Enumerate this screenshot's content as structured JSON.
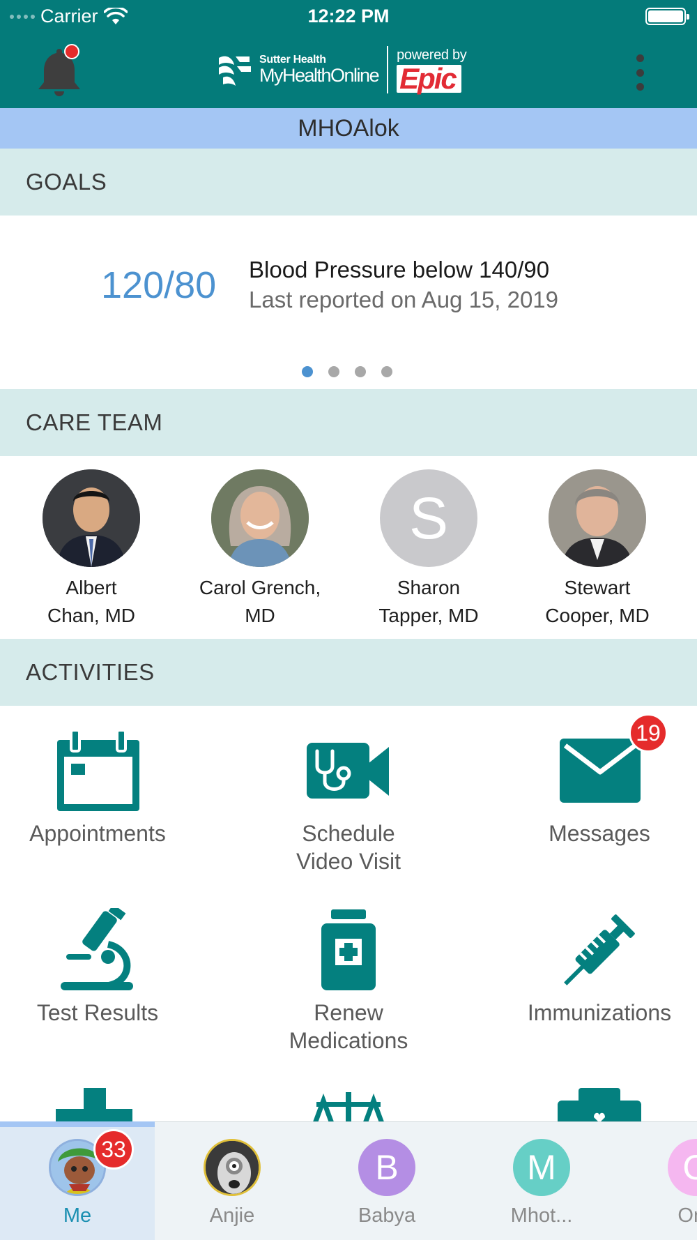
{
  "status_bar": {
    "carrier": "Carrier",
    "time": "12:22 PM"
  },
  "header": {
    "logo_brand_top": "Sutter Health",
    "logo_brand_name": "MyHealthOnline",
    "logo_powered_by": "powered by",
    "logo_epic": "Epic",
    "notification_dot_color": "#e52b2b"
  },
  "patient_name": "MHOAlok",
  "goals": {
    "section_title": "GOALS",
    "value": "120/80",
    "title": "Blood Pressure below 140/90",
    "subtitle": "Last reported on Aug 15, 2019",
    "page_count": 4,
    "active_page": 1
  },
  "care_team": {
    "section_title": "CARE TEAM",
    "providers": [
      {
        "line1": "Albert",
        "line2": "Chan, MD"
      },
      {
        "line1": "Carol Grench,",
        "line2": "MD"
      },
      {
        "line1": "Sharon",
        "line2": "Tapper, MD",
        "initial": "S"
      },
      {
        "line1": "Stewart",
        "line2": "Cooper, MD"
      }
    ]
  },
  "activities": {
    "section_title": "ACTIVITIES",
    "items": [
      {
        "label": "Appointments",
        "icon": "calendar-icon"
      },
      {
        "label1": "Schedule",
        "label2": "Video Visit",
        "icon": "video-stethoscope-icon"
      },
      {
        "label": "Messages",
        "icon": "envelope-icon",
        "badge": "19"
      },
      {
        "label": "Test Results",
        "icon": "microscope-icon"
      },
      {
        "label1": "Renew",
        "label2": "Medications",
        "icon": "medicine-bottle-icon"
      },
      {
        "label": "Immunizations",
        "icon": "syringe-icon"
      }
    ]
  },
  "tabs": [
    {
      "label": "Me",
      "badge": "33",
      "active": true
    },
    {
      "label": "Anjie"
    },
    {
      "label": "Babya",
      "initial": "B"
    },
    {
      "label": "Mhot...",
      "initial": "M"
    },
    {
      "label": "Onc",
      "initial": "O"
    }
  ],
  "colors": {
    "header_teal": "#047b7a",
    "accent_teal": "#04807f",
    "patient_bar": "#a4c6f4",
    "section_bg": "#d6ebeb",
    "goal_value_blue": "#4c92d0",
    "badge_red": "#e52b2b"
  }
}
